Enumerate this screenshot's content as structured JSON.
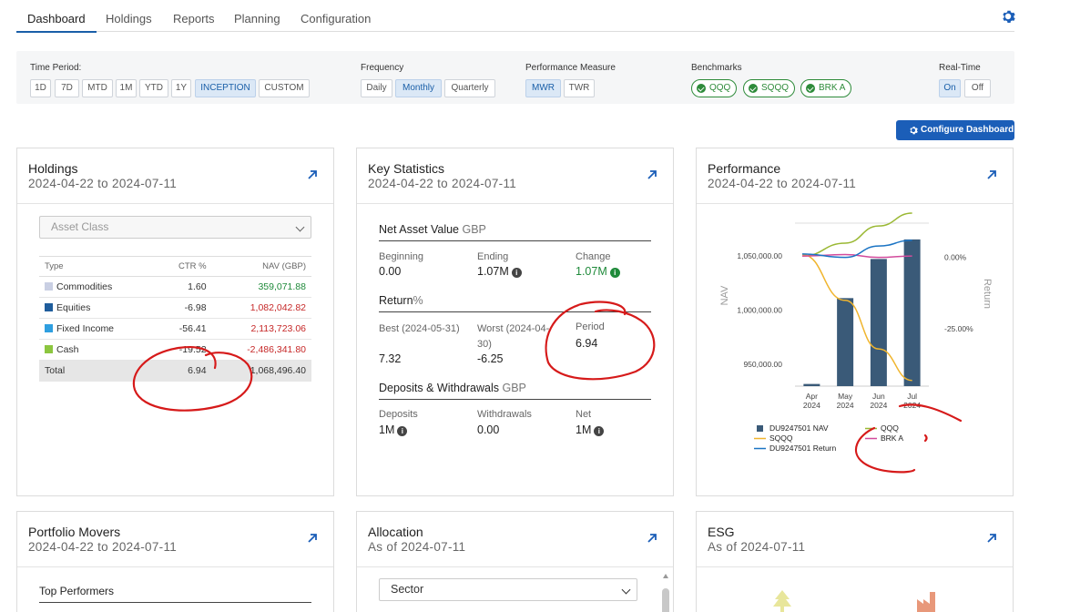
{
  "tabs": [
    "Dashboard",
    "Holdings",
    "Reports",
    "Planning",
    "Configuration"
  ],
  "filters": {
    "time_period": {
      "label": "Time Period:",
      "options": [
        "1D",
        "7D",
        "MTD",
        "1M",
        "YTD",
        "1Y",
        "INCEPTION",
        "CUSTOM"
      ],
      "selected": "INCEPTION"
    },
    "frequency": {
      "label": "Frequency",
      "options": [
        "Daily",
        "Monthly",
        "Quarterly"
      ],
      "selected": "Monthly"
    },
    "performance_measure": {
      "label": "Performance Measure",
      "options": [
        "MWR",
        "TWR"
      ],
      "selected": "MWR"
    },
    "benchmarks": {
      "label": "Benchmarks",
      "items": [
        "QQQ",
        "SQQQ",
        "BRK A"
      ]
    },
    "realtime": {
      "label": "Real-Time",
      "options": [
        "On",
        "Off"
      ],
      "selected": "On"
    }
  },
  "configure_label": "Configure Dashboard",
  "holdings": {
    "title": "Holdings",
    "subtitle": "2024-04-22 to 2024-07-11",
    "select": "Asset Class",
    "columns": [
      "Type",
      "CTR %",
      "NAV (GBP)"
    ],
    "rows": [
      {
        "type": "Commodities",
        "ctr": "1.60",
        "nav": "359,071.88",
        "color": "#c9cfe3",
        "sign": "pos"
      },
      {
        "type": "Equities",
        "ctr": "-6.98",
        "nav": "1,082,042.82",
        "color": "#1f5d9c",
        "sign": "neg"
      },
      {
        "type": "Fixed Income",
        "ctr": "-56.41",
        "nav": "2,113,723.06",
        "color": "#2f9fe0",
        "sign": "neg"
      },
      {
        "type": "Cash",
        "ctr": "-19.52",
        "nav": "-2,486,341.80",
        "color": "#8cc63f",
        "sign": "neg"
      }
    ],
    "total": {
      "label": "Total",
      "ctr": "6.94",
      "nav": "1,068,496.40"
    }
  },
  "key_stats": {
    "title": "Key Statistics",
    "subtitle": "2024-04-22 to 2024-07-11",
    "nav_head": "Net Asset Value",
    "nav_ccy": "GBP",
    "beginning_label": "Beginning",
    "beginning": "0.00",
    "ending_label": "Ending",
    "ending": "1.07M",
    "change_label": "Change",
    "change": "1.07M",
    "return_head": "Return",
    "return_unit": "%",
    "best_label": "Best (2024-05-31)",
    "best": "7.32",
    "worst_label": "Worst (2024-04-30)",
    "worst": "-6.25",
    "period_label": "Period",
    "period": "6.94",
    "dw_head": "Deposits & Withdrawals",
    "dw_ccy": "GBP",
    "deposits_label": "Deposits",
    "deposits": "1M",
    "withdrawals_label": "Withdrawals",
    "withdrawals": "0.00",
    "net_label": "Net",
    "net": "1M"
  },
  "performance": {
    "title": "Performance",
    "subtitle": "2024-04-22 to 2024-07-11"
  },
  "portfolio_movers": {
    "title": "Portfolio Movers",
    "subtitle": "2024-04-22 to 2024-07-11",
    "top": "Top Performers"
  },
  "allocation": {
    "title": "Allocation",
    "subtitle": "As of 2024-07-11",
    "select": "Sector"
  },
  "esg": {
    "title": "ESG",
    "subtitle": "As of 2024-07-11"
  },
  "chart_data": {
    "type": "bar",
    "categories": [
      "Apr 2024",
      "May 2024",
      "Jun 2024",
      "Jul 2024"
    ],
    "ylabel": "NAV",
    "y2label": "Return",
    "ylim": [
      930000,
      1080000
    ],
    "y2lim": [
      -0.45,
      0.12
    ],
    "yticks": [
      "950,000.00",
      "1,000,000.00",
      "1,050,000.00"
    ],
    "y2ticks": [
      "-25.00%",
      "0.00%"
    ],
    "series": [
      {
        "name": "DU9247501 NAV",
        "type": "bar",
        "color": "#3a5a78",
        "values": [
          932000,
          1011000,
          1047000,
          1065000
        ]
      },
      {
        "name": "QQQ",
        "type": "line",
        "color": "#9ab833",
        "values": [
          0.005,
          0.05,
          0.11,
          0.155
        ]
      },
      {
        "name": "SQQQ",
        "type": "line",
        "color": "#f0b52e",
        "values": [
          0.01,
          -0.15,
          -0.32,
          -0.43
        ]
      },
      {
        "name": "BRK A",
        "type": "line",
        "color": "#d24b9c",
        "values": [
          0.005,
          0.01,
          0.0,
          0.005
        ]
      },
      {
        "name": "DU9247501 Return",
        "type": "line",
        "color": "#1b74c4",
        "values": [
          0.012,
          0.0,
          0.04,
          0.06
        ]
      }
    ]
  }
}
